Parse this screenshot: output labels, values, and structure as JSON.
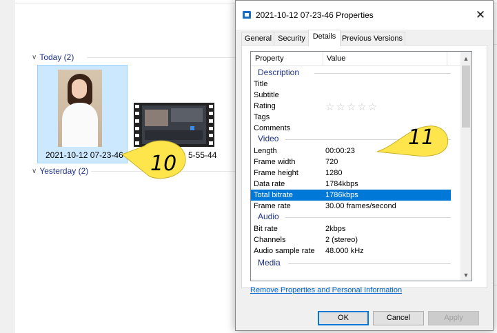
{
  "explorer": {
    "groups": [
      {
        "label": "Today (2)"
      },
      {
        "label": "Yesterday (2)"
      }
    ],
    "items": [
      {
        "caption": "2021-10-12 07-23-46"
      },
      {
        "caption": "5-55-44"
      }
    ]
  },
  "callouts": [
    {
      "number": "10"
    },
    {
      "number": "11"
    }
  ],
  "dialog": {
    "title": "2021-10-12 07-23-46 Properties",
    "close_glyph": "✕",
    "tabs": [
      "General",
      "Security",
      "Details",
      "Previous Versions"
    ],
    "active_tab": "Details",
    "columns": {
      "property": "Property",
      "value": "Value"
    },
    "sections": {
      "description": "Description",
      "video": "Video",
      "audio": "Audio",
      "media": "Media"
    },
    "description_rows": [
      {
        "key": "Title",
        "value": ""
      },
      {
        "key": "Subtitle",
        "value": ""
      },
      {
        "key": "Rating",
        "value": ""
      },
      {
        "key": "Tags",
        "value": ""
      },
      {
        "key": "Comments",
        "value": ""
      }
    ],
    "rating_stars": "☆☆☆☆☆",
    "rating_value": 0,
    "video_rows": [
      {
        "key": "Length",
        "value": "00:00:23"
      },
      {
        "key": "Frame width",
        "value": "720"
      },
      {
        "key": "Frame height",
        "value": "1280"
      },
      {
        "key": "Data rate",
        "value": "1784kbps"
      },
      {
        "key": "Total bitrate",
        "value": "1786kbps"
      },
      {
        "key": "Frame rate",
        "value": "30.00 frames/second"
      }
    ],
    "selected_row": "Total bitrate",
    "audio_rows": [
      {
        "key": "Bit rate",
        "value": "2kbps"
      },
      {
        "key": "Channels",
        "value": "2 (stereo)"
      },
      {
        "key": "Audio sample rate",
        "value": "48.000 kHz"
      }
    ],
    "remove_link": "Remove Properties and Personal Information",
    "buttons": {
      "ok": "OK",
      "cancel": "Cancel",
      "apply": "Apply"
    }
  },
  "colors": {
    "selection": "#0078d7",
    "section_text": "#1e3287",
    "callout_fill": "#fde54b",
    "link": "#0066cc"
  }
}
